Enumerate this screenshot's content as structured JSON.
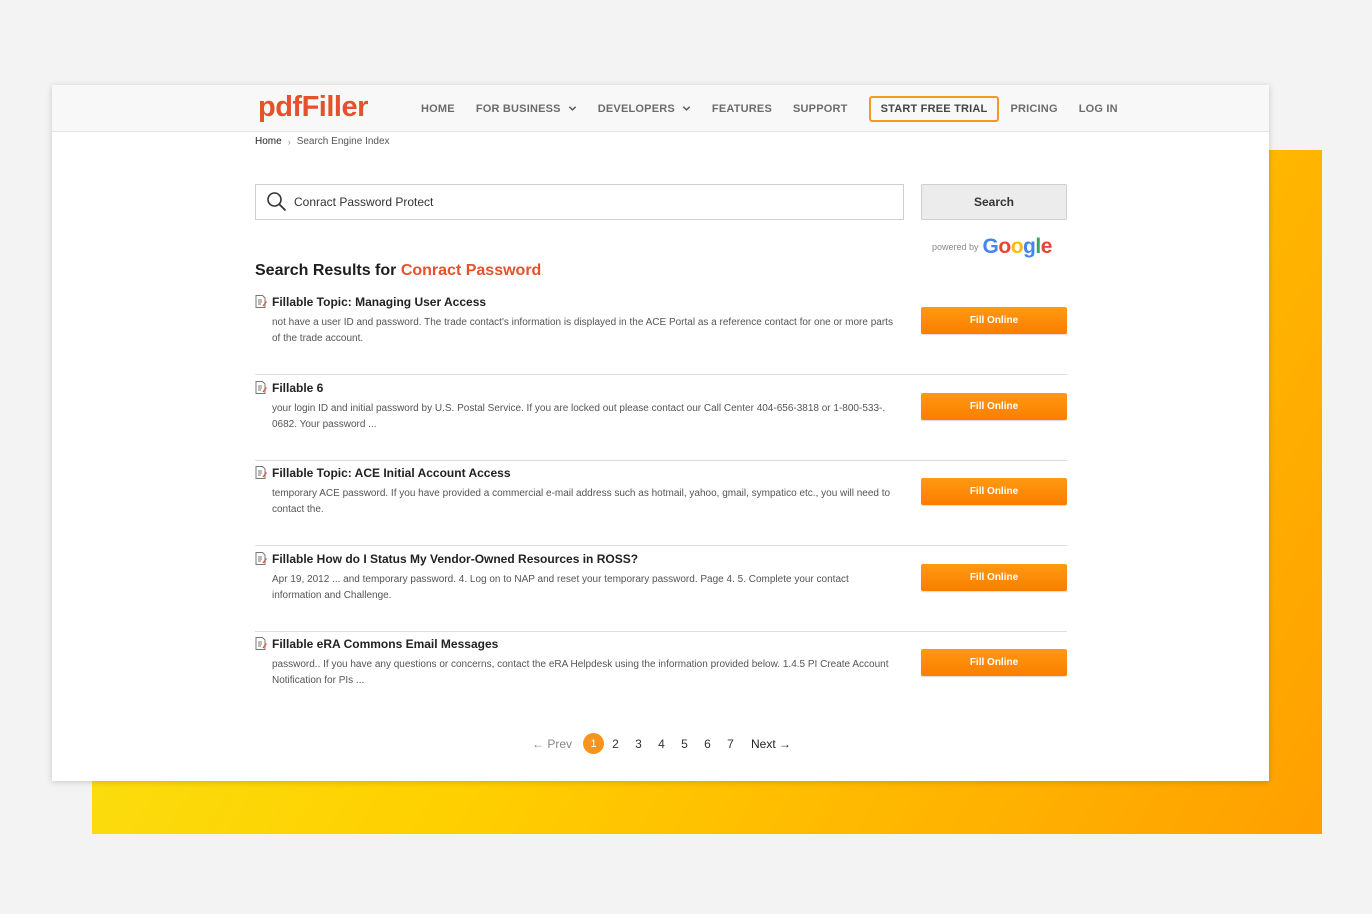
{
  "header": {
    "logo": "pdfFiller",
    "nav": [
      {
        "label": "HOME",
        "dropdown": false
      },
      {
        "label": "FOR BUSINESS",
        "dropdown": true
      },
      {
        "label": "DEVELOPERS",
        "dropdown": true
      },
      {
        "label": "FEATURES",
        "dropdown": false
      },
      {
        "label": "SUPPORT",
        "dropdown": false
      }
    ],
    "trial_button": "START FREE TRIAL",
    "pricing": "PRICING",
    "login": "LOG IN"
  },
  "breadcrumb": {
    "home": "Home",
    "current": "Search Engine Index"
  },
  "search": {
    "value": "Conract Password Protect",
    "button": "Search",
    "powered_by": "powered by"
  },
  "results_heading": {
    "prefix": "Search Results for ",
    "query": "Conract Password"
  },
  "results": [
    {
      "title": "Fillable Topic: Managing User Access",
      "desc": "not have a user ID and password. The trade contact's information is displayed in the ACE Portal as a reference contact for one or more parts of the trade account.",
      "button": "Fill Online"
    },
    {
      "title": "Fillable 6",
      "desc": "your login ID and initial password by U.S. Postal Service. If you are locked out please contact our Call Center 404-656-3818 or 1-800-533-. 0682. Your password ...",
      "button": "Fill Online"
    },
    {
      "title": "Fillable Topic: ACE Initial Account Access",
      "desc": "temporary ACE password. If you have provided a commercial e-mail address such as hotmail, yahoo, gmail, sympatico etc., you will need to contact the.",
      "button": "Fill Online"
    },
    {
      "title": "Fillable How do I Status My Vendor-Owned Resources in ROSS?",
      "desc": "Apr 19, 2012 ... and temporary password. 4. Log on to NAP and reset your temporary password. Page 4. 5. Complete your contact information and Challenge.",
      "button": "Fill Online"
    },
    {
      "title": "Fillable eRA Commons Email Messages",
      "desc": "password.. If you have any questions or concerns, contact the eRA Helpdesk using the information provided below. 1.4.5 PI Create Account Notification for PIs  ...",
      "button": "Fill Online"
    }
  ],
  "pagination": {
    "prev": "← Prev",
    "pages": [
      "1",
      "2",
      "3",
      "4",
      "5",
      "6",
      "7"
    ],
    "current": "1",
    "next": "Next →"
  },
  "colors": {
    "brand": "#e4512b",
    "accent": "#fb8a0a",
    "trial_border": "#f29a1f"
  }
}
